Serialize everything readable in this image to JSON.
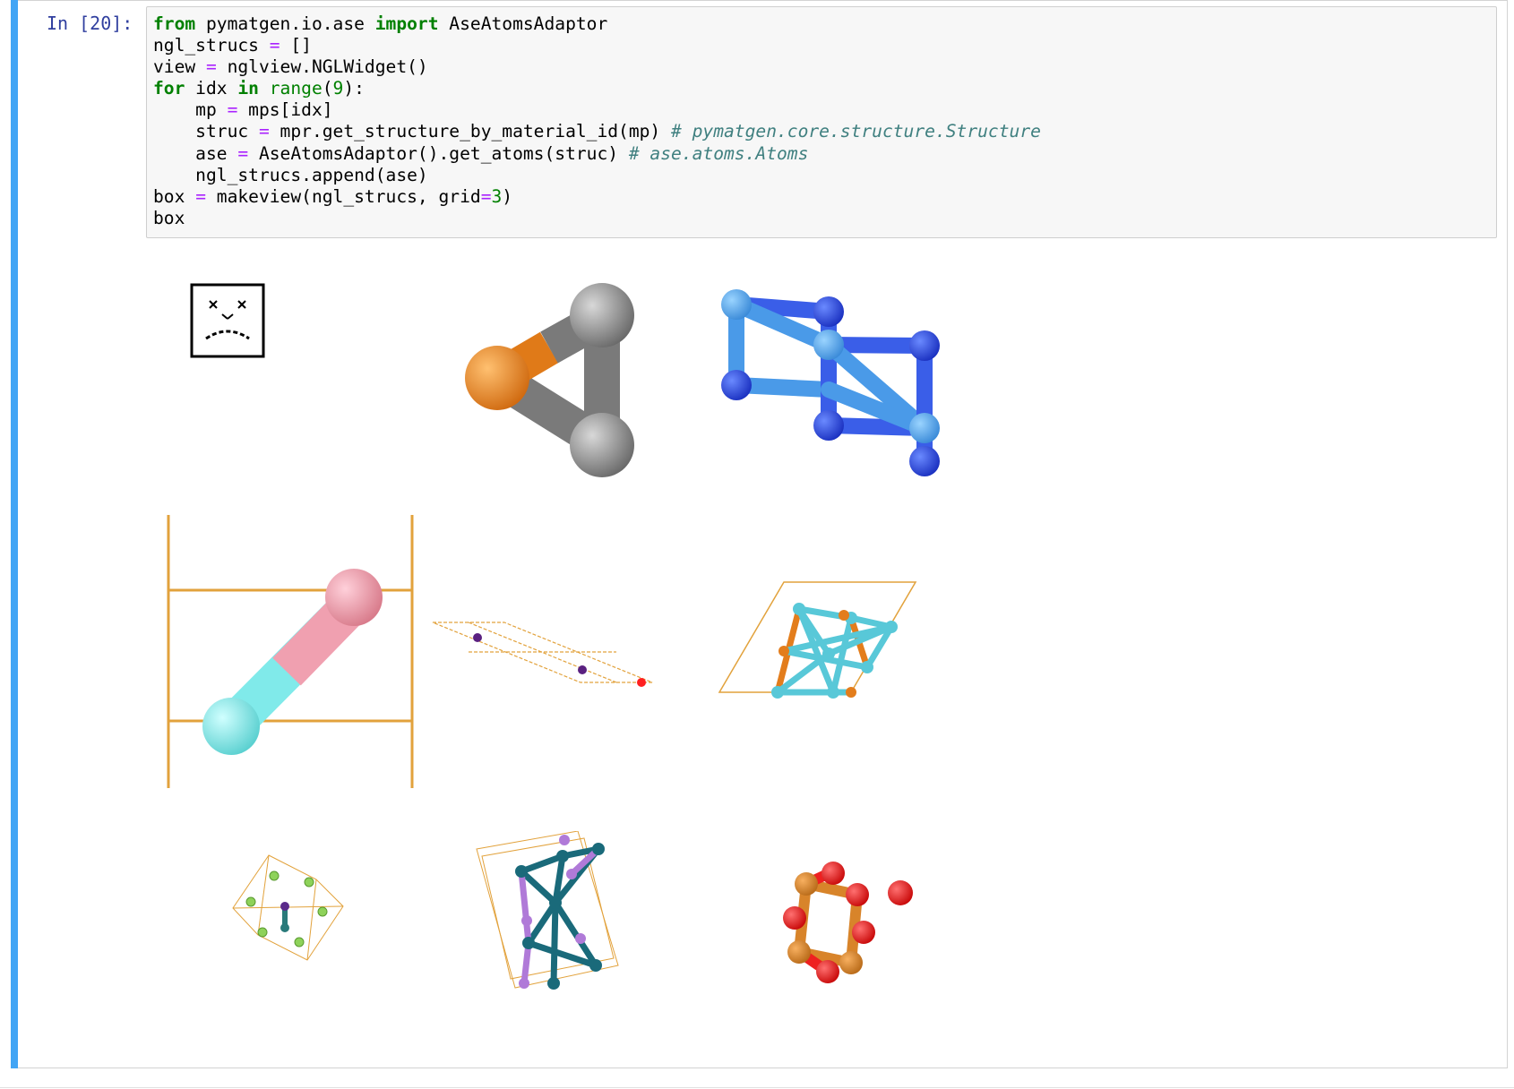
{
  "cell": {
    "prompt": "In [20]:",
    "code_lines": [
      [
        {
          "t": "from",
          "c": "kw"
        },
        {
          "t": " pymatgen.io.ase "
        },
        {
          "t": "import",
          "c": "kw"
        },
        {
          "t": " AseAtomsAdaptor"
        }
      ],
      [
        {
          "t": "ngl_strucs "
        },
        {
          "t": "=",
          "c": "op"
        },
        {
          "t": " []"
        }
      ],
      [
        {
          "t": "view "
        },
        {
          "t": "=",
          "c": "op"
        },
        {
          "t": " nglview.NGLWidget()"
        }
      ],
      [
        {
          "t": "for",
          "c": "kw"
        },
        {
          "t": " idx "
        },
        {
          "t": "in",
          "c": "kw"
        },
        {
          "t": " "
        },
        {
          "t": "range",
          "c": "bi"
        },
        {
          "t": "("
        },
        {
          "t": "9",
          "c": "num"
        },
        {
          "t": "):"
        }
      ],
      [
        {
          "t": "    mp "
        },
        {
          "t": "=",
          "c": "op"
        },
        {
          "t": " mps[idx]"
        }
      ],
      [
        {
          "t": "    struc "
        },
        {
          "t": "=",
          "c": "op"
        },
        {
          "t": " mpr.get_structure_by_material_id(mp) "
        },
        {
          "t": "# pymatgen.core.structure.Structure",
          "c": "cm"
        }
      ],
      [
        {
          "t": "    ase "
        },
        {
          "t": "=",
          "c": "op"
        },
        {
          "t": " AseAtomsAdaptor().get_atoms(struc) "
        },
        {
          "t": "# ase.atoms.Atoms",
          "c": "cm"
        }
      ],
      [
        {
          "t": "    ngl_strucs.append(ase)"
        }
      ],
      [
        {
          "t": "box "
        },
        {
          "t": "=",
          "c": "op"
        },
        {
          "t": " makeview(ngl_strucs, grid"
        },
        {
          "t": "=",
          "c": "op"
        },
        {
          "t": "3",
          "c": "num"
        },
        {
          "t": ")"
        }
      ],
      [
        {
          "t": "box"
        }
      ]
    ]
  },
  "viewers": [
    {
      "name": "viewer-1-broken-icon",
      "state": "error",
      "icon": "sad-face-icon"
    },
    {
      "name": "viewer-2-structure",
      "state": "rendered",
      "colors": [
        "#f28a22",
        "#8a8a8a"
      ]
    },
    {
      "name": "viewer-3-structure",
      "state": "rendered",
      "colors": [
        "#2d4fe0",
        "#4aa3ea"
      ]
    },
    {
      "name": "viewer-4-structure",
      "state": "rendered",
      "colors": [
        "#f0a0b0",
        "#80eaea",
        "#e2a23c"
      ]
    },
    {
      "name": "viewer-5-structure",
      "state": "rendered",
      "colors": [
        "#6a2a8a",
        "#ff2020",
        "#e2a23c"
      ]
    },
    {
      "name": "viewer-6-structure",
      "state": "rendered",
      "colors": [
        "#58c8d8",
        "#e37d1c",
        "#e2a23c"
      ]
    },
    {
      "name": "viewer-7-structure",
      "state": "rendered",
      "colors": [
        "#8ed25a",
        "#5a2a8a",
        "#2a7a7a"
      ]
    },
    {
      "name": "viewer-8-structure",
      "state": "rendered",
      "colors": [
        "#1a6a7a",
        "#b07ad8",
        "#e2a23c"
      ]
    },
    {
      "name": "viewer-9-structure",
      "state": "rendered",
      "colors": [
        "#ee2020",
        "#d8842a"
      ]
    }
  ]
}
